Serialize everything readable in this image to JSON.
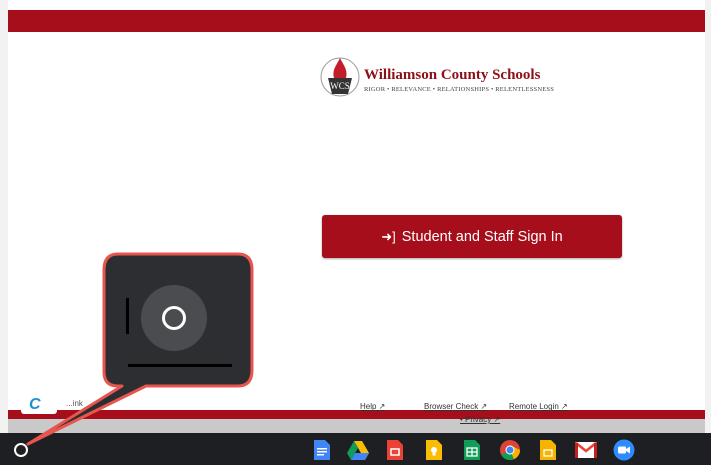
{
  "header": {
    "color": "#a50e1a"
  },
  "logo": {
    "title": "Williamson County Schools",
    "subtitle": "RIGOR • RELEVANCE • RELATIONSHIPS • RELENTLESSNESS"
  },
  "signin": {
    "label": "Student and Staff Sign In"
  },
  "footer": {
    "help": "Help",
    "browser_check": "Browser Check",
    "remote_login": "Remote Login",
    "privacy": "Privacy",
    "badge_text": "...ink"
  },
  "shelf": {
    "apps": [
      "docs-icon",
      "drive-icon",
      "slides-icon",
      "keep-icon",
      "sheets-icon",
      "chrome-icon",
      "files-icon",
      "gmail-icon",
      "meet-icon"
    ]
  }
}
